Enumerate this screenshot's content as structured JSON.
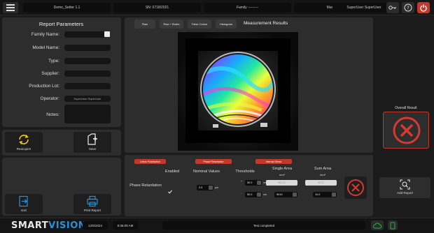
{
  "topbar": {
    "recipe": "Demo_Setter 1.1",
    "serial": "SN: 0718/2021",
    "family": "Family ---------",
    "master": "Master ---------",
    "user": "SuperUser SuperUser"
  },
  "report": {
    "title": "Report Parameters",
    "fields": [
      {
        "label": "Family Name:",
        "value": ""
      },
      {
        "label": "Model Name:",
        "value": ""
      },
      {
        "label": "Type:",
        "value": ""
      },
      {
        "label": "Supplier:",
        "value": ""
      },
      {
        "label": "Production Lot:",
        "value": ""
      },
      {
        "label": "Operator:",
        "value": "SuperUser SuperUser"
      },
      {
        "label": "Notes:",
        "value": ""
      }
    ]
  },
  "actions": {
    "reacquire": "Reacquire",
    "save": "Save",
    "exit": "Exit",
    "print": "Print Report",
    "add_report": "Add Report"
  },
  "measurement": {
    "title": "Measurement Results",
    "view_buttons": [
      "Raw",
      "Raw + Bndrs",
      "False Colors",
      "Histogram"
    ]
  },
  "analysis": {
    "tabs": [
      "Linear Polarisation",
      "Phase Retardation",
      "Internal Stress"
    ],
    "headers": {
      "enabled": "Enabled",
      "nominal": "Nominal Values",
      "thresholds": "Thresholds",
      "single_area": "Single Area",
      "sum_area": "Sum Area",
      "unit_area": "mm²"
    },
    "row_label": "Phase Retardation",
    "nominal_value": "2.0",
    "nominal_unit": "µm",
    "plus": "+",
    "minus": "-",
    "thr_plus": "50.0",
    "thr_minus": "50.0",
    "thr_unit": "nm",
    "single_top": "661.00",
    "sum_top": "99.37",
    "single_bottom": "9019",
    "sum_bottom": "10.0"
  },
  "overall": {
    "title": "Overall Result"
  },
  "bottombar": {
    "date": "12/5/2024",
    "time": "8:36:09 AM",
    "status": "Test completed"
  },
  "brand": {
    "part1": "SMART",
    "part2": "VISION"
  },
  "colors": {
    "accent_red": "#c0392b",
    "result_red": "#d43a2f",
    "brand_blue": "#2a8fd6",
    "ok_green": "#29b34a"
  }
}
